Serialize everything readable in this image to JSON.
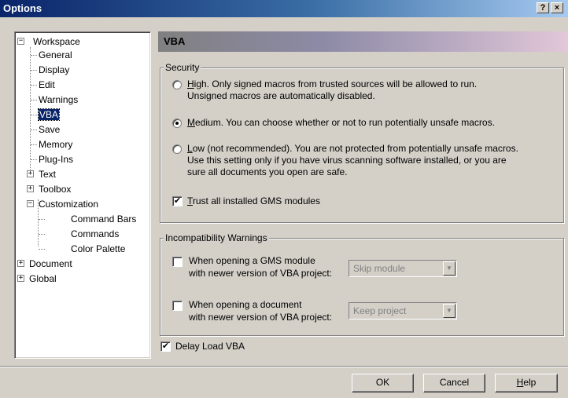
{
  "window": {
    "title": "Options",
    "help_label": "?",
    "close_label": "×"
  },
  "tree": {
    "workspace": "Workspace",
    "general": "General",
    "display": "Display",
    "edit": "Edit",
    "warnings": "Warnings",
    "vba": "VBA",
    "save": "Save",
    "memory": "Memory",
    "plugins": "Plug-Ins",
    "text": "Text",
    "toolbox": "Toolbox",
    "customization": "Customization",
    "command_bars": "Command Bars",
    "commands": "Commands",
    "color_palette": "Color Palette",
    "document": "Document",
    "global": "Global",
    "expanded_glyph": "−",
    "collapsed_glyph": "+"
  },
  "panel": {
    "title": "VBA"
  },
  "security": {
    "legend": "Security",
    "selected": "medium",
    "high": {
      "key": "H",
      "rest": "igh.",
      "line1": " Only signed macros from trusted sources will be allowed to run.",
      "line2": "Unsigned macros are automatically disabled."
    },
    "medium": {
      "key": "M",
      "rest": "edium.",
      "line1": " You can choose whether or not to run potentially unsafe macros."
    },
    "low": {
      "key": "L",
      "rest": "ow (not recommended).",
      "line1": " You are not protected from potentially unsafe macros.",
      "line2": "Use this setting only if you have virus scanning software installed, or you are",
      "line3": "sure all documents you open are safe."
    },
    "trust": {
      "checked": true,
      "key": "T",
      "rest": "rust all installed GMS modules"
    }
  },
  "incompat": {
    "legend": "Incompatibility Warnings",
    "gms": {
      "checked": false,
      "line1": "When opening a GMS module",
      "line2": "with newer version of VBA project:",
      "select_value": "Skip module"
    },
    "doc": {
      "checked": false,
      "line1": "When opening a document",
      "line2": "with newer version of VBA project:",
      "select_value": "Keep project"
    }
  },
  "delay_load": {
    "checked": true,
    "label": "Delay Load VBA"
  },
  "check_glyph": "✔",
  "arrow_glyph": "▼",
  "buttons": {
    "ok": "OK",
    "cancel": "Cancel",
    "help_key": "H",
    "help_rest": "elp"
  }
}
